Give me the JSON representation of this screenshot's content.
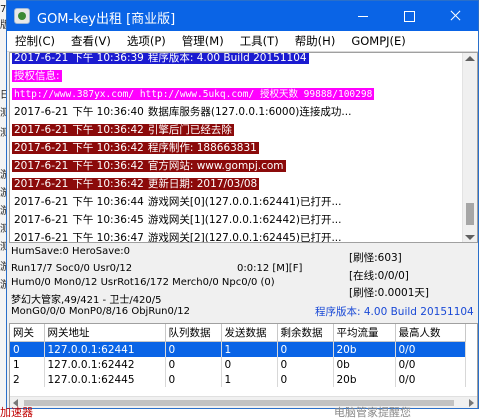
{
  "window": {
    "title": "GOM-key出租 [商业版]"
  },
  "menu": [
    "控制(C)",
    "查看(V)",
    "选项(P)",
    "管理(M)",
    "工具(T)",
    "帮助(H)",
    "GOMPJ(E)"
  ],
  "log": [
    {
      "date": "2017-6-21",
      "time": "下午 10:36:39",
      "msg": "程序版本: 4.00 Build 20151104",
      "style": "top"
    },
    {
      "date": "",
      "time": "",
      "msg": "授权信息:",
      "style": "mag"
    },
    {
      "date": "",
      "time": "",
      "msg": "http://www.387yx.com/ http://www.5ukq.com/ 授权天数 99888/100298",
      "style": "mag"
    },
    {
      "date": "2017-6-21",
      "time": "下午 10:36:40",
      "msg": "数据库服务器(127.0.0.1:6000)连接成功...",
      "style": ""
    },
    {
      "date": "2017-6-21",
      "time": "下午 10:36:42",
      "msg": "引擎后门已经去除",
      "style": "red"
    },
    {
      "date": "2017-6-21",
      "time": "下午 10:36:42",
      "msg": "程序制作: 188663831",
      "style": "red"
    },
    {
      "date": "2017-6-21",
      "time": "下午 10:36:42",
      "msg": "官方网站: www.gompj.com",
      "style": "red"
    },
    {
      "date": "2017-6-21",
      "time": "下午 10:36:42",
      "msg": "更新日期: 2017/03/08",
      "style": "red"
    },
    {
      "date": "2017-6-21",
      "time": "下午 10:36:44",
      "msg": "游戏网关[0](127.0.0.1:62441)已打开...",
      "style": ""
    },
    {
      "date": "2017-6-21",
      "time": "下午 10:36:45",
      "msg": "游戏网关[1](127.0.0.1:62442)已打开...",
      "style": ""
    },
    {
      "date": "2017-6-21",
      "time": "下午 10:36:47",
      "msg": "游戏网关[2](127.0.0.1:62445)已打开...",
      "style": ""
    }
  ],
  "status": {
    "line1": "HumSave:0 HeroSave:0",
    "line2": "Run17/7 Soc0/0 Usr0/12",
    "line3": "Hum0/0 Mon0/12 UsrRot16/172 Merch0/0 Npc0/0 (0)",
    "line4": "梦幻大管家,49/421 - 卫士/420/5",
    "line5": "MonG0/0/0 MonP0/8/16 ObjRun0/12",
    "timer": "0:0:12 [M][F]",
    "refresh": "[刷怪:603]",
    "online": "[在线:0/0/0]",
    "brush": "[刷怪:0.0001天]",
    "version": "程序版本: 4.00 Build 20151104"
  },
  "grid": {
    "headers": [
      "网关",
      "网关地址",
      "队列数据",
      "发送数据",
      "剩余数据",
      "平均流量",
      "最高人数"
    ],
    "rows": [
      [
        "0",
        "127.0.0.1:62441",
        "0",
        "1",
        "0",
        "20b",
        "0/0"
      ],
      [
        "1",
        "127.0.0.1:62442",
        "0",
        "0",
        "0",
        "0b",
        "0/0"
      ],
      [
        "2",
        "127.0.0.1:62445",
        "0",
        "1",
        "0",
        "20b",
        "0/0"
      ]
    ]
  },
  "background": {
    "left_fragments": [
      "7",
      "版",
      "日",
      "测",
      "测",
      "游",
      "游",
      "游",
      "测",
      "测",
      "游",
      "游"
    ],
    "bottom_left": "加速器",
    "bottom_right": "电脑管家提醒您"
  }
}
